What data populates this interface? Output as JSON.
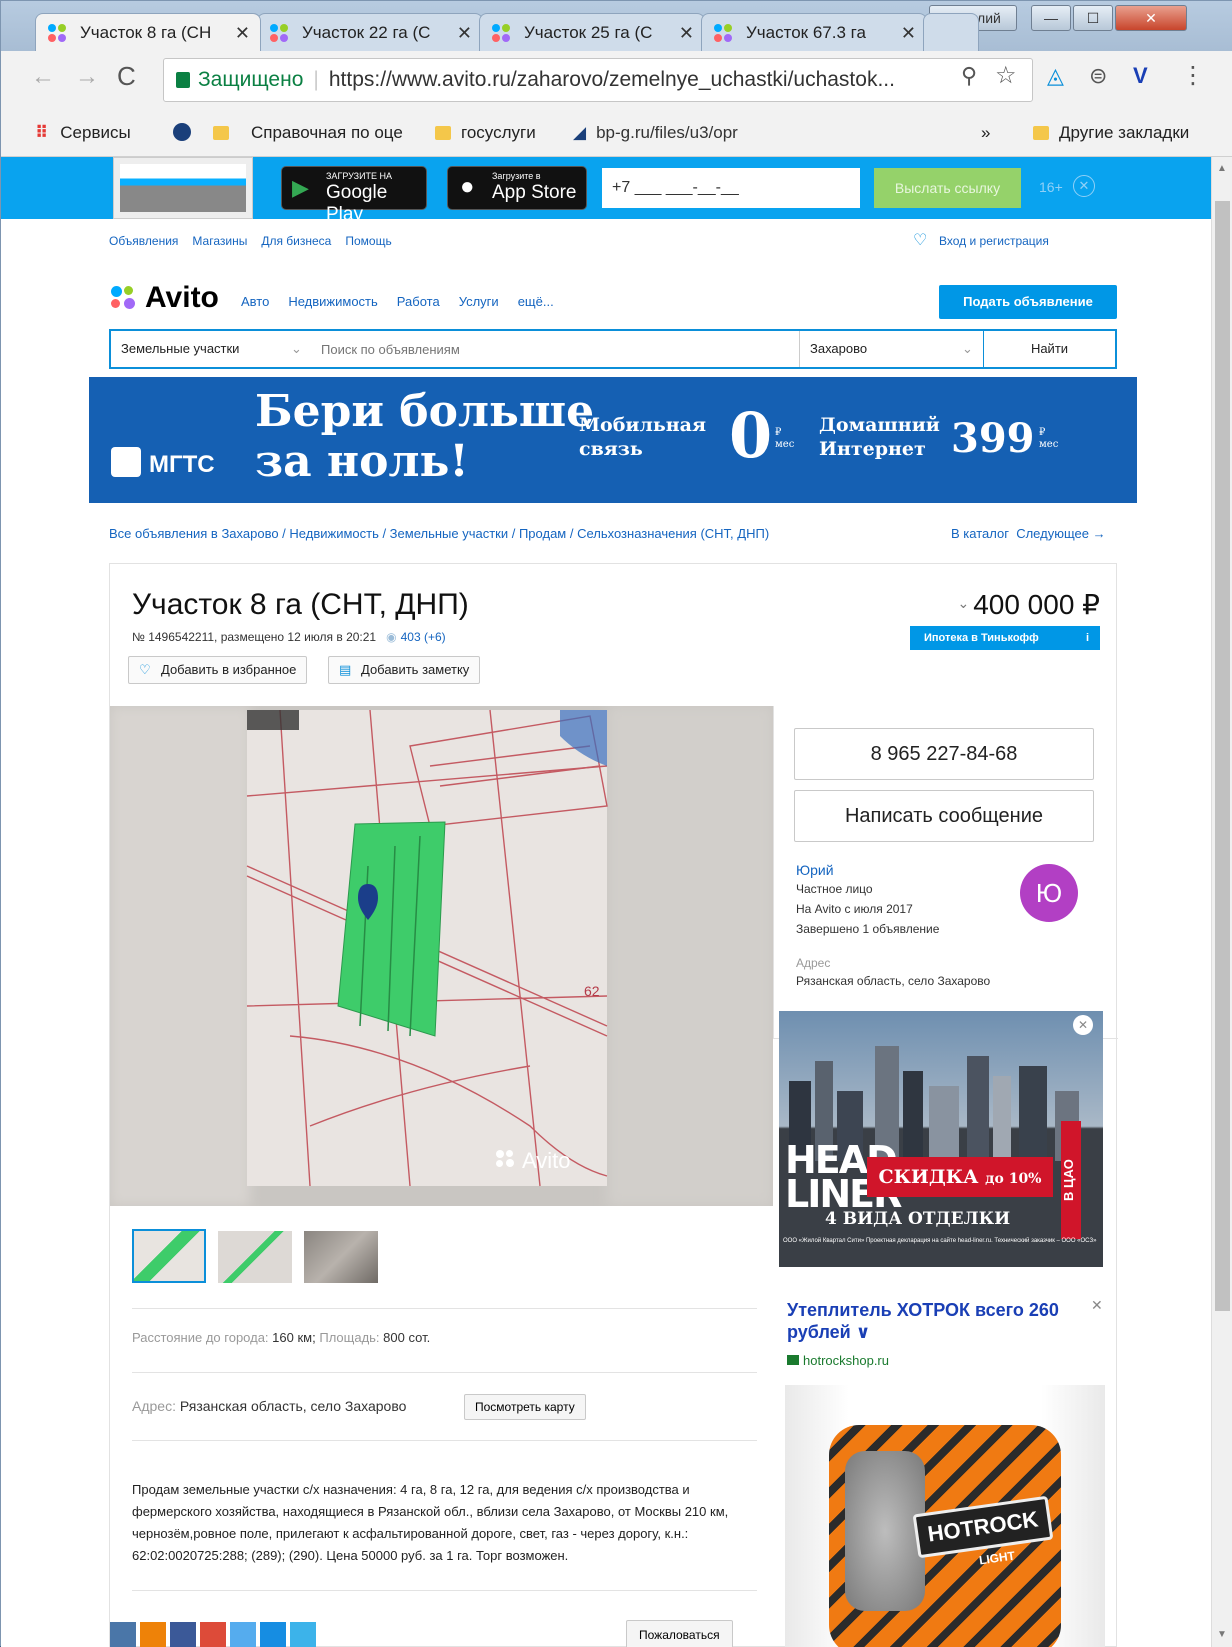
{
  "window": {
    "user": "Василий",
    "minimize": "—",
    "maximize": "☐",
    "close": "✕"
  },
  "tabs": [
    {
      "title": "Участок 8 га (СН"
    },
    {
      "title": "Участок 22 га (С"
    },
    {
      "title": "Участок 25 га (С"
    },
    {
      "title": "Участок 67.3 га"
    }
  ],
  "omnibar": {
    "secure": "Защищено",
    "url": "https://www.avito.ru/zaharovo/zemelnye_uchastki/uchastok..."
  },
  "bookmarks": {
    "apps": "Сервисы",
    "b1": "Справочная по оце",
    "b2": "госуслуги",
    "b3": "bp-g.ru/files/u3/opr",
    "more": "»",
    "other": "Другие закладки"
  },
  "appbar": {
    "gplay_small": "ЗАГРУЗИТЕ НА",
    "gplay": "Google Play",
    "apple_small": "Загрузите в",
    "apple": "App Store",
    "phone_value": "+7 ___ ___-__-__",
    "send": "Выслать ссылку",
    "age": "16+"
  },
  "topnav": {
    "items": [
      "Объявления",
      "Магазины",
      "Для бизнеса",
      "Помощь"
    ],
    "login": "Вход и регистрация"
  },
  "header": {
    "logo": "Avito",
    "nav": [
      "Авто",
      "Недвижимость",
      "Работа",
      "Услуги",
      "ещё..."
    ],
    "post": "Подать объявление"
  },
  "search": {
    "category": "Земельные участки",
    "placeholder": "Поиск по объявлениям",
    "location": "Захарово",
    "submit": "Найти"
  },
  "banner": {
    "brand": "МГТС",
    "headline1": "Бери больше",
    "headline2": "за ноль!",
    "mobile1": "Мобильная",
    "mobile2": "связь",
    "mobile_price": "0",
    "internet1": "Домашний",
    "internet2": "Интернет",
    "internet_price": "399",
    "currency": "₽",
    "per": "мес"
  },
  "breadcrumbs": {
    "path": "Все объявления в Захарово / Недвижимость / Земельные участки / Продам / Сельхозназначения (СНТ, ДНП)",
    "catalog": "В каталог",
    "next": "Следующее →"
  },
  "listing": {
    "title": "Участок 8 га (СНТ, ДНП)",
    "number": "№ 1496542211, размещено 12 июля в 20:21",
    "views": "403 (+6)",
    "price": "400 000 ₽",
    "mortgage": "Ипотека в Тинькофф",
    "fav": "Добавить в избранное",
    "note": "Добавить заметку",
    "watermark": "Avito"
  },
  "seller": {
    "phone": "8 965 227-84-68",
    "message": "Написать сообщение",
    "name": "Юрий",
    "type": "Частное лицо",
    "since": "На Avito с июля 2017",
    "done": "Завершено 1 объявление",
    "addr_label": "Адрес",
    "addr": "Рязанская область, село Захарово",
    "avatar": "Ю"
  },
  "params": {
    "dist_label": "Расстояние до города:",
    "dist": "160 км;",
    "area_label": "Площадь:",
    "area": "800 сот.",
    "addr_label": "Адрес:",
    "addr": "Рязанская область, село Захарово",
    "map": "Посмотреть карту"
  },
  "description": "Продам земельные участки с/х назначения: 4 га, 8 га, 12 га, для ведения с/х производства и фермерского хозяйства, находящиеся в Рязанской обл., вблизи села Захарово, от Москвы 210 км, чернозём,ровное поле, прилегают к асфальтированной дороге, свет, газ - через дорогу, к.н.: 62:02:0020725:288; (289); (290). Цена 50000 руб. за 1 га. Торг возможен.",
  "ads": {
    "ad1_l1": "HEAD",
    "ad1_l2": "LINER",
    "ad1_sale": "СКИДКА",
    "ad1_pct": "до 10%",
    "ad1_finish": "4 ВИДА ОТДЕЛКИ",
    "ad1_cao": "В ЦАО",
    "ad1_fine": "ООО «Жилой Квартал Сити» Проектная декларация на сайте head-liner.ru. Технический заказчик – ООО «ОСЗ»",
    "ad2_title": "Утеплитель ХОТРОК всего 260 рублей ∨",
    "ad2_site": "hotrockshop.ru",
    "ad2_brand": "HOTROCK",
    "ad2_sub": "LIGHT"
  },
  "footer": {
    "complain": "Пожаловаться"
  }
}
